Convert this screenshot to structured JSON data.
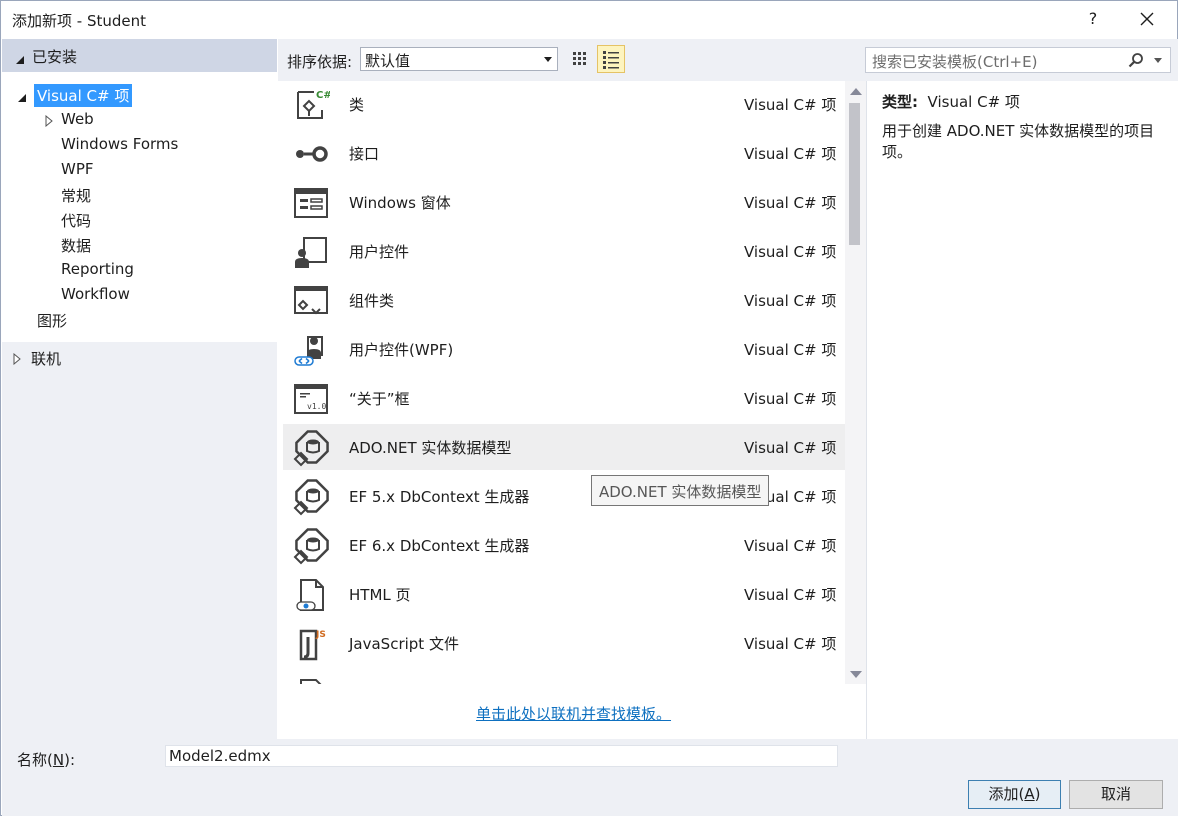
{
  "window": {
    "title": "添加新项 - Student",
    "help_label": "?"
  },
  "left_panel": {
    "installed_label": "已安装",
    "selected_node": "Visual C# 项",
    "children": [
      "Web",
      "Windows Forms",
      "WPF",
      "常规",
      "代码",
      "数据",
      "Reporting",
      "Workflow"
    ],
    "graphics_label": "图形",
    "online_label": "联机"
  },
  "toolbar": {
    "sort_label": "排序依据:",
    "sort_value": "默认值",
    "search_placeholder": "搜索已安装模板(Ctrl+E)"
  },
  "templates": [
    {
      "name": "类",
      "type": "Visual C# 项",
      "icon": "class-icon"
    },
    {
      "name": "接口",
      "type": "Visual C# 项",
      "icon": "interface-icon"
    },
    {
      "name": "Windows 窗体",
      "type": "Visual C# 项",
      "icon": "windows-form-icon"
    },
    {
      "name": "用户控件",
      "type": "Visual C# 项",
      "icon": "user-control-icon"
    },
    {
      "name": "组件类",
      "type": "Visual C# 项",
      "icon": "component-class-icon"
    },
    {
      "name": "用户控件(WPF)",
      "type": "Visual C# 项",
      "icon": "wpf-user-control-icon"
    },
    {
      "name": "“关于”框",
      "type": "Visual C# 项",
      "icon": "about-box-icon"
    },
    {
      "name": "ADO.NET 实体数据模型",
      "type": "Visual C# 项",
      "icon": "entity-model-icon"
    },
    {
      "name": "EF 5.x DbContext 生成器",
      "type": "Visual C# 项",
      "icon": "entity-model-icon"
    },
    {
      "name": "EF 6.x DbContext 生成器",
      "type": "Visual C# 项",
      "icon": "entity-model-icon"
    },
    {
      "name": "HTML 页",
      "type": "Visual C# 项",
      "icon": "html-page-icon"
    },
    {
      "name": "JavaScript 文件",
      "type": "Visual C# 项",
      "icon": "javascript-file-icon"
    }
  ],
  "tooltip": "ADO.NET 实体数据模型",
  "online_link": "单击此处以联机并查找模板。",
  "detail": {
    "type_label": "类型:",
    "type_value": "Visual C# 项",
    "description": "用于创建 ADO.NET 实体数据模型的项目项。"
  },
  "bottom": {
    "name_label_pre": "名称(",
    "name_label_key": "N",
    "name_label_post": "):",
    "name_value": "Model2.edmx",
    "add_pre": "添加(",
    "add_key": "A",
    "add_post": ")",
    "cancel_label": "取消"
  },
  "colors": {
    "selection": "#3399ff",
    "panel_bg": "#eef0f5",
    "header_bg": "#cfd6e5",
    "link": "#0e70c0"
  }
}
